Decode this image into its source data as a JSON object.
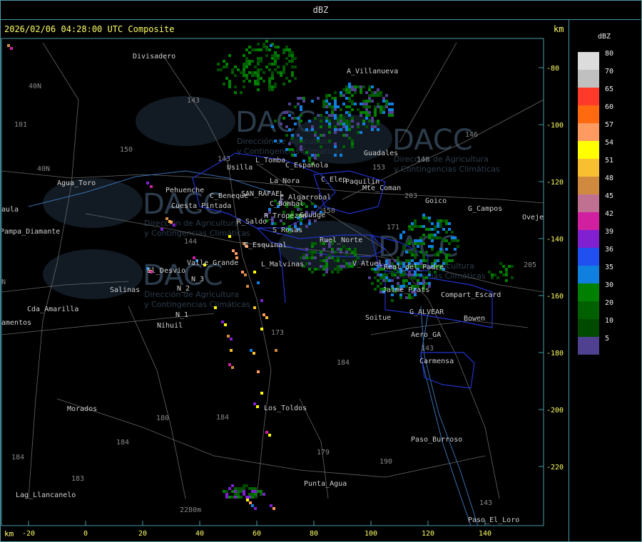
{
  "header": {
    "title": "dBZ"
  },
  "timestamp": "2026/02/06 04:28:00 UTC Composite",
  "units": {
    "top_right": "km",
    "bottom_left": "km"
  },
  "legend": {
    "title": "dBZ",
    "levels": [
      {
        "label": "80",
        "color": "#dcdcdc"
      },
      {
        "label": "70",
        "color": "#c0c0c0"
      },
      {
        "label": "65",
        "color": "#ff3a2a"
      },
      {
        "label": "60",
        "color": "#ff6a10"
      },
      {
        "label": "57",
        "color": "#ff9a60"
      },
      {
        "label": "54",
        "color": "#ffff00"
      },
      {
        "label": "51",
        "color": "#f8c030"
      },
      {
        "label": "48",
        "color": "#d08a40"
      },
      {
        "label": "45",
        "color": "#c07090"
      },
      {
        "label": "42",
        "color": "#d020a0"
      },
      {
        "label": "39",
        "color": "#8020d0"
      },
      {
        "label": "36",
        "color": "#2050f0"
      },
      {
        "label": "35",
        "color": "#1080e0"
      },
      {
        "label": "30",
        "color": "#008000"
      },
      {
        "label": "20",
        "color": "#006000"
      },
      {
        "label": "10",
        "color": "#004a00"
      },
      {
        "label": "5",
        "color": "#504090"
      }
    ]
  },
  "y_axis_labels": [
    "-80",
    "-100",
    "-120",
    "-140",
    "-160",
    "-180",
    "-200",
    "-220"
  ],
  "x_axis_labels": [
    "-20",
    "0",
    "20",
    "40",
    "60",
    "80",
    "100",
    "120",
    "140"
  ],
  "places": [
    {
      "name": "Divisadero"
    },
    {
      "name": "A_Villanueva"
    },
    {
      "name": "Guadales"
    },
    {
      "name": "Usilla"
    },
    {
      "name": "L_Tomba"
    },
    {
      "name": "C_Española"
    },
    {
      "name": "C_Elep"
    },
    {
      "name": "Paquilin"
    },
    {
      "name": "Mte_Coman"
    },
    {
      "name": "La_Nora"
    },
    {
      "name": "C_Beneque"
    },
    {
      "name": "SAN_RAFAEL"
    },
    {
      "name": "E_Algarrobal"
    },
    {
      "name": "C_Bombal"
    },
    {
      "name": "Goico"
    },
    {
      "name": "G_Campos"
    },
    {
      "name": "Ovejero"
    },
    {
      "name": "Agua_Toro"
    },
    {
      "name": "Pampa_Diamante"
    },
    {
      "name": "Cuesta_Pintada"
    },
    {
      "name": "Pehuenche"
    },
    {
      "name": "R_Saldo"
    },
    {
      "name": "S_Rosas"
    },
    {
      "name": "R_Tropezon"
    },
    {
      "name": "Goudge"
    },
    {
      "name": "Ruel_Norte"
    },
    {
      "name": "E_Esquinal"
    },
    {
      "name": "L_Malvinas"
    },
    {
      "name": "V_Atuel"
    },
    {
      "name": "Real_del_Padre"
    },
    {
      "name": "El_Desvio"
    },
    {
      "name": "Valle_Grande"
    },
    {
      "name": "Salinas"
    },
    {
      "name": "N_2"
    },
    {
      "name": "N_1"
    },
    {
      "name": "N_3"
    },
    {
      "name": "Nihuil"
    },
    {
      "name": "Cda_Amarilla"
    },
    {
      "name": "Jaime_Prats"
    },
    {
      "name": "Compart_Escard"
    },
    {
      "name": "G_ALVEAR"
    },
    {
      "name": "Soitue"
    },
    {
      "name": "Bowen"
    },
    {
      "name": "Aero_GA"
    },
    {
      "name": "Carmensa"
    },
    {
      "name": "Morados"
    },
    {
      "name": "Los_Toldos"
    },
    {
      "name": "Paso_Burroso"
    },
    {
      "name": "Punta_Agua"
    },
    {
      "name": "Lag_Llancanelo"
    },
    {
      "name": "Paso_El_Loro"
    },
    {
      "name": "aula"
    },
    {
      "name": "amentos"
    }
  ],
  "watermark": {
    "brand": "DACC",
    "line1": "Dirección de Agricultura",
    "line2": "y Contingencias Climáticas"
  }
}
